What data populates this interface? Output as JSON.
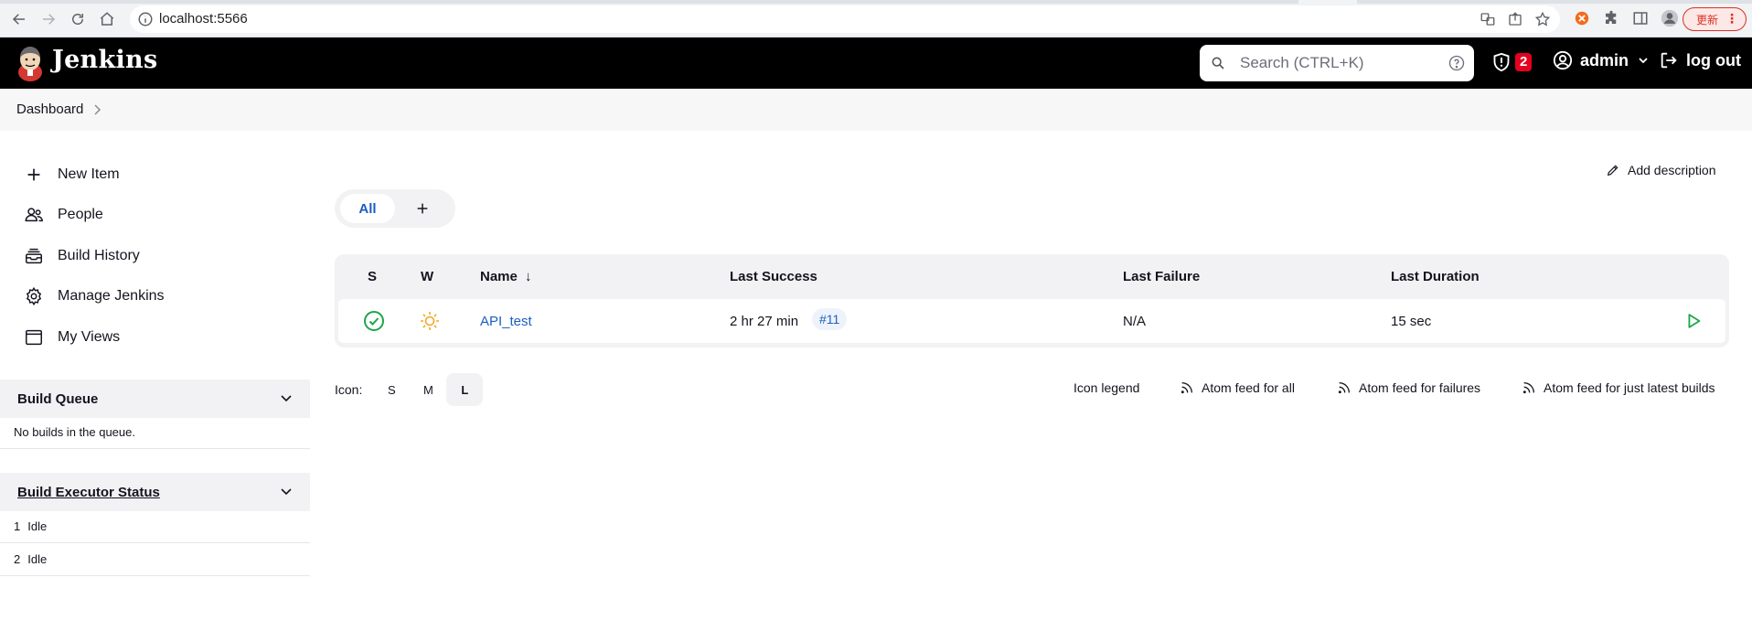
{
  "browser": {
    "url": "localhost:5566",
    "update_label": "更新"
  },
  "header": {
    "brand": "Jenkins",
    "search_placeholder": "Search (CTRL+K)",
    "security_count": "2",
    "user": "admin",
    "logout": "log out"
  },
  "breadcrumb": {
    "items": [
      "Dashboard"
    ]
  },
  "sidebar": {
    "tasks": [
      "New Item",
      "People",
      "Build History",
      "Manage Jenkins",
      "My Views"
    ],
    "build_queue": {
      "title": "Build Queue",
      "empty": "No builds in the queue."
    },
    "executors": {
      "title": "Build Executor Status",
      "rows": [
        {
          "num": "1",
          "state": "Idle"
        },
        {
          "num": "2",
          "state": "Idle"
        }
      ]
    }
  },
  "main": {
    "add_description": "Add description",
    "tabs": [
      {
        "label": "All"
      }
    ],
    "table": {
      "headers": {
        "s": "S",
        "w": "W",
        "name": "Name",
        "name_sort": "↓",
        "last_success": "Last Success",
        "last_failure": "Last Failure",
        "last_duration": "Last Duration"
      },
      "rows": [
        {
          "status": "success",
          "weather": "sunny",
          "name": "API_test",
          "last_success": "2 hr 27 min",
          "last_success_build": "#11",
          "last_failure": "N/A",
          "last_duration": "15 sec"
        }
      ]
    },
    "icon_size": {
      "label": "Icon:",
      "options": [
        "S",
        "M",
        "L"
      ],
      "selected": "L"
    },
    "footer_links": {
      "legend": "Icon legend",
      "feed_all": "Atom feed for all",
      "feed_failures": "Atom feed for failures",
      "feed_latest": "Atom feed for just latest builds"
    }
  },
  "colors": {
    "header_bg": "#000000",
    "link": "#1b5fc2",
    "success": "#1ea64b",
    "badge": "#e6001f"
  }
}
